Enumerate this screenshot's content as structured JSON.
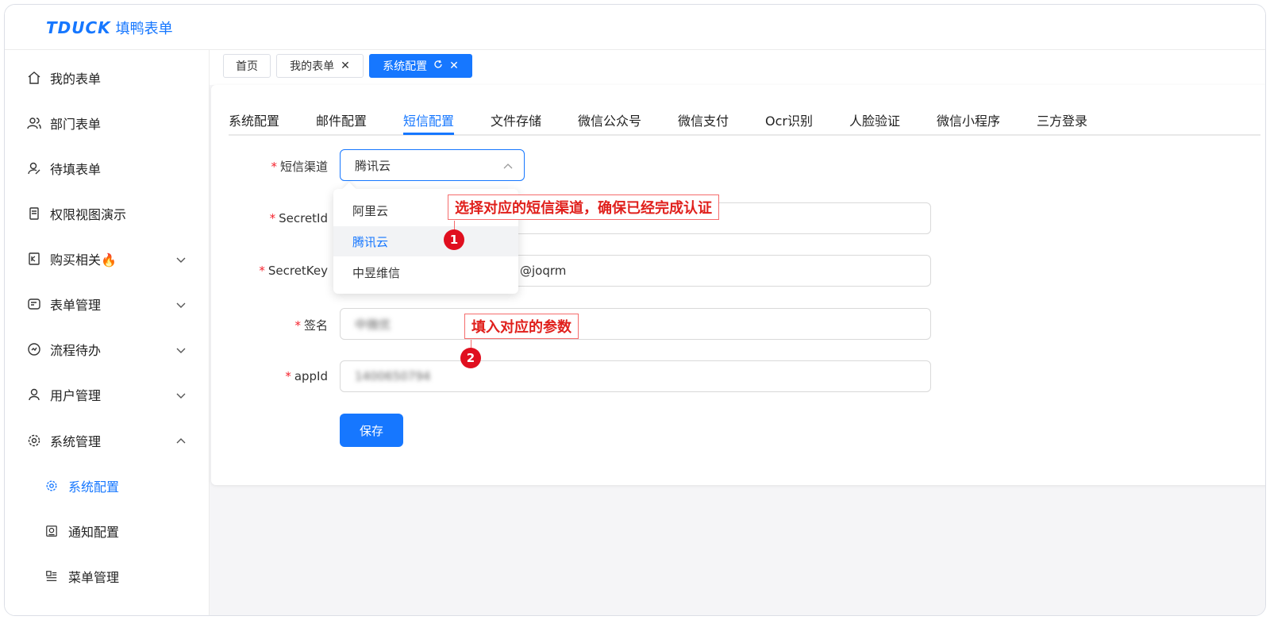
{
  "app": {
    "brand": "TDUCK",
    "name": "填鸭表单"
  },
  "sidebar": {
    "items": [
      {
        "label": "我的表单",
        "icon": "home-icon"
      },
      {
        "label": "部门表单",
        "icon": "users-icon"
      },
      {
        "label": "待填表单",
        "icon": "user-edit-icon"
      },
      {
        "label": "权限视图演示",
        "icon": "document-icon"
      },
      {
        "label": "购买相关🔥",
        "icon": "receipt-icon"
      },
      {
        "label": "表单管理",
        "icon": "form-icon"
      },
      {
        "label": "流程待办",
        "icon": "flow-icon"
      },
      {
        "label": "用户管理",
        "icon": "user-icon"
      },
      {
        "label": "系统管理",
        "icon": "gear-icon"
      }
    ],
    "sub_items": [
      {
        "label": "系统配置",
        "icon": "gear-icon"
      },
      {
        "label": "通知配置",
        "icon": "notice-icon"
      },
      {
        "label": "菜单管理",
        "icon": "menu-icon"
      }
    ]
  },
  "page_tabs": [
    {
      "label": "首页"
    },
    {
      "label": "我的表单"
    },
    {
      "label": "系统配置"
    }
  ],
  "sub_tabs": [
    "系统配置",
    "邮件配置",
    "短信配置",
    "文件存储",
    "微信公众号",
    "微信支付",
    "Ocr识别",
    "人脸验证",
    "微信小程序",
    "三方登录"
  ],
  "form": {
    "channel_label": "短信渠道",
    "channel_value": "腾讯云",
    "secret_id_label": "SecretId",
    "secret_key_label": "SecretKey",
    "secret_key_value": "@joqrm",
    "sign_label": "签名",
    "sign_value": "中微优",
    "app_id_label": "appId",
    "app_id_value": "1400650794",
    "save_label": "保存"
  },
  "dropdown": {
    "options": [
      "阿里云",
      "腾讯云",
      "中昱维信"
    ],
    "selected": "腾讯云"
  },
  "annotations": {
    "callout_1": "选择对应的短信渠道，确保已经完成认证",
    "badge_1": "1",
    "callout_2": "填入对应的参数",
    "badge_2": "2"
  },
  "colors": {
    "accent": "#1677ff",
    "required": "#f5222d",
    "annotation": "#e0201c"
  }
}
